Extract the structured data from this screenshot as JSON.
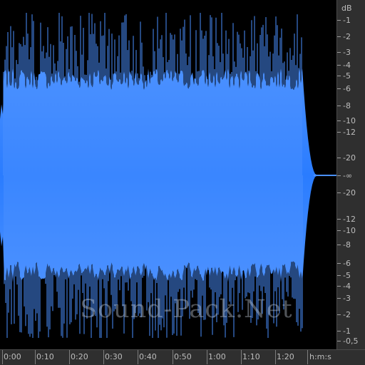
{
  "watermark": "Sound-Pack.Net",
  "colors": {
    "background": "#000000",
    "waveform_top": "#4a90ff",
    "waveform_mid": "#2a7cff",
    "ruler_background": "#2f2f2f",
    "ruler_text": "#bdbdbd"
  },
  "db_ruler": {
    "unit_label": "dB",
    "labels": [
      "-1",
      "-2",
      "-3",
      "-4",
      "-5",
      "-6",
      "-8",
      "-10",
      "-12",
      "-20",
      "-∞",
      "-20",
      "-12",
      "-10",
      "-8",
      "-6",
      "-5",
      "-4",
      "-3",
      "-2",
      "-1",
      "-0,5"
    ]
  },
  "time_ruler": {
    "unit_label": "h:m:s",
    "labels": [
      "0:00",
      "0:10",
      "0:20",
      "0:30",
      "0:40",
      "0:50",
      "1:00",
      "1:10",
      "1:20"
    ]
  }
}
